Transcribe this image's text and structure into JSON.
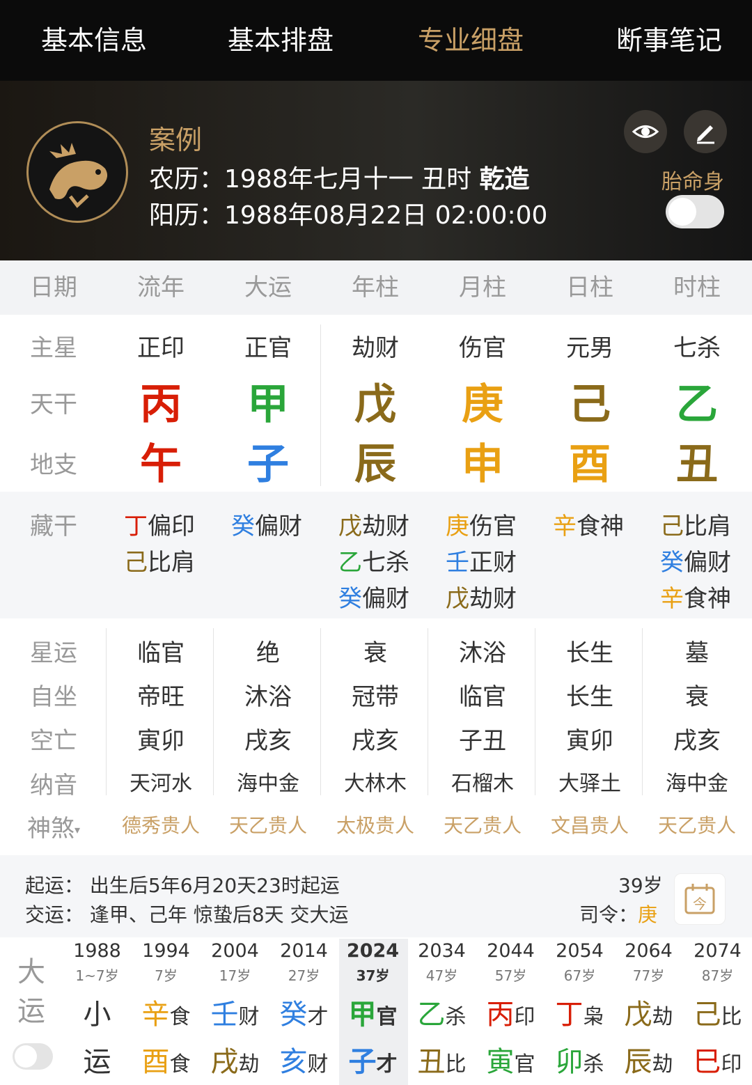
{
  "nav": {
    "tabs": [
      "基本信息",
      "基本排盘",
      "专业细盘",
      "断事笔记"
    ],
    "active_index": 2
  },
  "header": {
    "title": "案例",
    "lunar_label": "农历：",
    "lunar_value": "1988年七月十一 丑时",
    "gender": "乾造",
    "solar_label": "阳历：",
    "solar_value": "1988年08月22日 02:00:00",
    "taimingshen_label": "胎命身"
  },
  "columns": [
    "日期",
    "流年",
    "大运",
    "年柱",
    "月柱",
    "日柱",
    "时柱"
  ],
  "rows": {
    "zhuxing": {
      "label": "主星",
      "values": [
        "正印",
        "正官",
        "劫财",
        "伤官",
        "元男",
        "七杀"
      ]
    },
    "tiangan": {
      "label": "天干",
      "values": [
        "丙",
        "甲",
        "戊",
        "庚",
        "己",
        "乙"
      ]
    },
    "dizhi": {
      "label": "地支",
      "values": [
        "午",
        "子",
        "辰",
        "申",
        "酉",
        "丑"
      ]
    },
    "canggan": {
      "label": "藏干",
      "cols": [
        [
          {
            "g": "丁",
            "s": "偏印"
          },
          {
            "g": "己",
            "s": "比肩"
          }
        ],
        [
          {
            "g": "癸",
            "s": "偏财"
          }
        ],
        [
          {
            "g": "戊",
            "s": "劫财"
          },
          {
            "g": "乙",
            "s": "七杀"
          },
          {
            "g": "癸",
            "s": "偏财"
          }
        ],
        [
          {
            "g": "庚",
            "s": "伤官"
          },
          {
            "g": "壬",
            "s": "正财"
          },
          {
            "g": "戊",
            "s": "劫财"
          }
        ],
        [
          {
            "g": "辛",
            "s": "食神"
          }
        ],
        [
          {
            "g": "己",
            "s": "比肩"
          },
          {
            "g": "癸",
            "s": "偏财"
          },
          {
            "g": "辛",
            "s": "食神"
          }
        ]
      ]
    },
    "xingyun": {
      "label": "星运",
      "values": [
        "临官",
        "绝",
        "衰",
        "沐浴",
        "长生",
        "墓"
      ]
    },
    "zizuo": {
      "label": "自坐",
      "values": [
        "帝旺",
        "沐浴",
        "冠带",
        "临官",
        "长生",
        "衰"
      ]
    },
    "kongwang": {
      "label": "空亡",
      "values": [
        "寅卯",
        "戌亥",
        "戌亥",
        "子丑",
        "寅卯",
        "戌亥"
      ]
    },
    "nayin": {
      "label": "纳音",
      "values": [
        "天河水",
        "海中金",
        "大林木",
        "石榴木",
        "大驿土",
        "海中金"
      ]
    },
    "shensha": {
      "label": "神煞",
      "values": [
        "德秀贵人",
        "天乙贵人",
        "太极贵人",
        "天乙贵人",
        "文昌贵人",
        "天乙贵人"
      ]
    }
  },
  "qiyun": {
    "qiyun_label": "起运：",
    "qiyun_value": "出生后5年6月20天23时起运",
    "jiaoyun_label": "交运：",
    "jiaoyun_value": "逢甲、己年 惊蛰后8天 交大运",
    "age": "39岁",
    "siling_label": "司令：",
    "siling_value": "庚"
  },
  "dayun": {
    "label": "大运",
    "current_index": 4,
    "items": [
      {
        "year": "1988",
        "age": "1~7岁",
        "top": "小",
        "top_s": "",
        "bot": "运",
        "bot_s": ""
      },
      {
        "year": "1994",
        "age": "7岁",
        "top": "辛",
        "top_s": "食",
        "bot": "酉",
        "bot_s": "食"
      },
      {
        "year": "2004",
        "age": "17岁",
        "top": "壬",
        "top_s": "财",
        "bot": "戌",
        "bot_s": "劫"
      },
      {
        "year": "2014",
        "age": "27岁",
        "top": "癸",
        "top_s": "才",
        "bot": "亥",
        "bot_s": "财"
      },
      {
        "year": "2024",
        "age": "37岁",
        "top": "甲",
        "top_s": "官",
        "bot": "子",
        "bot_s": "才"
      },
      {
        "year": "2034",
        "age": "47岁",
        "top": "乙",
        "top_s": "杀",
        "bot": "丑",
        "bot_s": "比"
      },
      {
        "year": "2044",
        "age": "57岁",
        "top": "丙",
        "top_s": "印",
        "bot": "寅",
        "bot_s": "官"
      },
      {
        "year": "2054",
        "age": "67岁",
        "top": "丁",
        "top_s": "枭",
        "bot": "卯",
        "bot_s": "杀"
      },
      {
        "year": "2064",
        "age": "77岁",
        "top": "戊",
        "top_s": "劫",
        "bot": "辰",
        "bot_s": "劫"
      },
      {
        "year": "2074",
        "age": "87岁",
        "top": "己",
        "top_s": "比",
        "bot": "巳",
        "bot_s": "印"
      }
    ]
  },
  "colors": {
    "fire": "#d81e06",
    "wood": "#2aa63a",
    "water": "#2f7fe0",
    "earth": "#8a6a1a",
    "metal": "#e9a013",
    "gold_accent": "#c9a066"
  }
}
